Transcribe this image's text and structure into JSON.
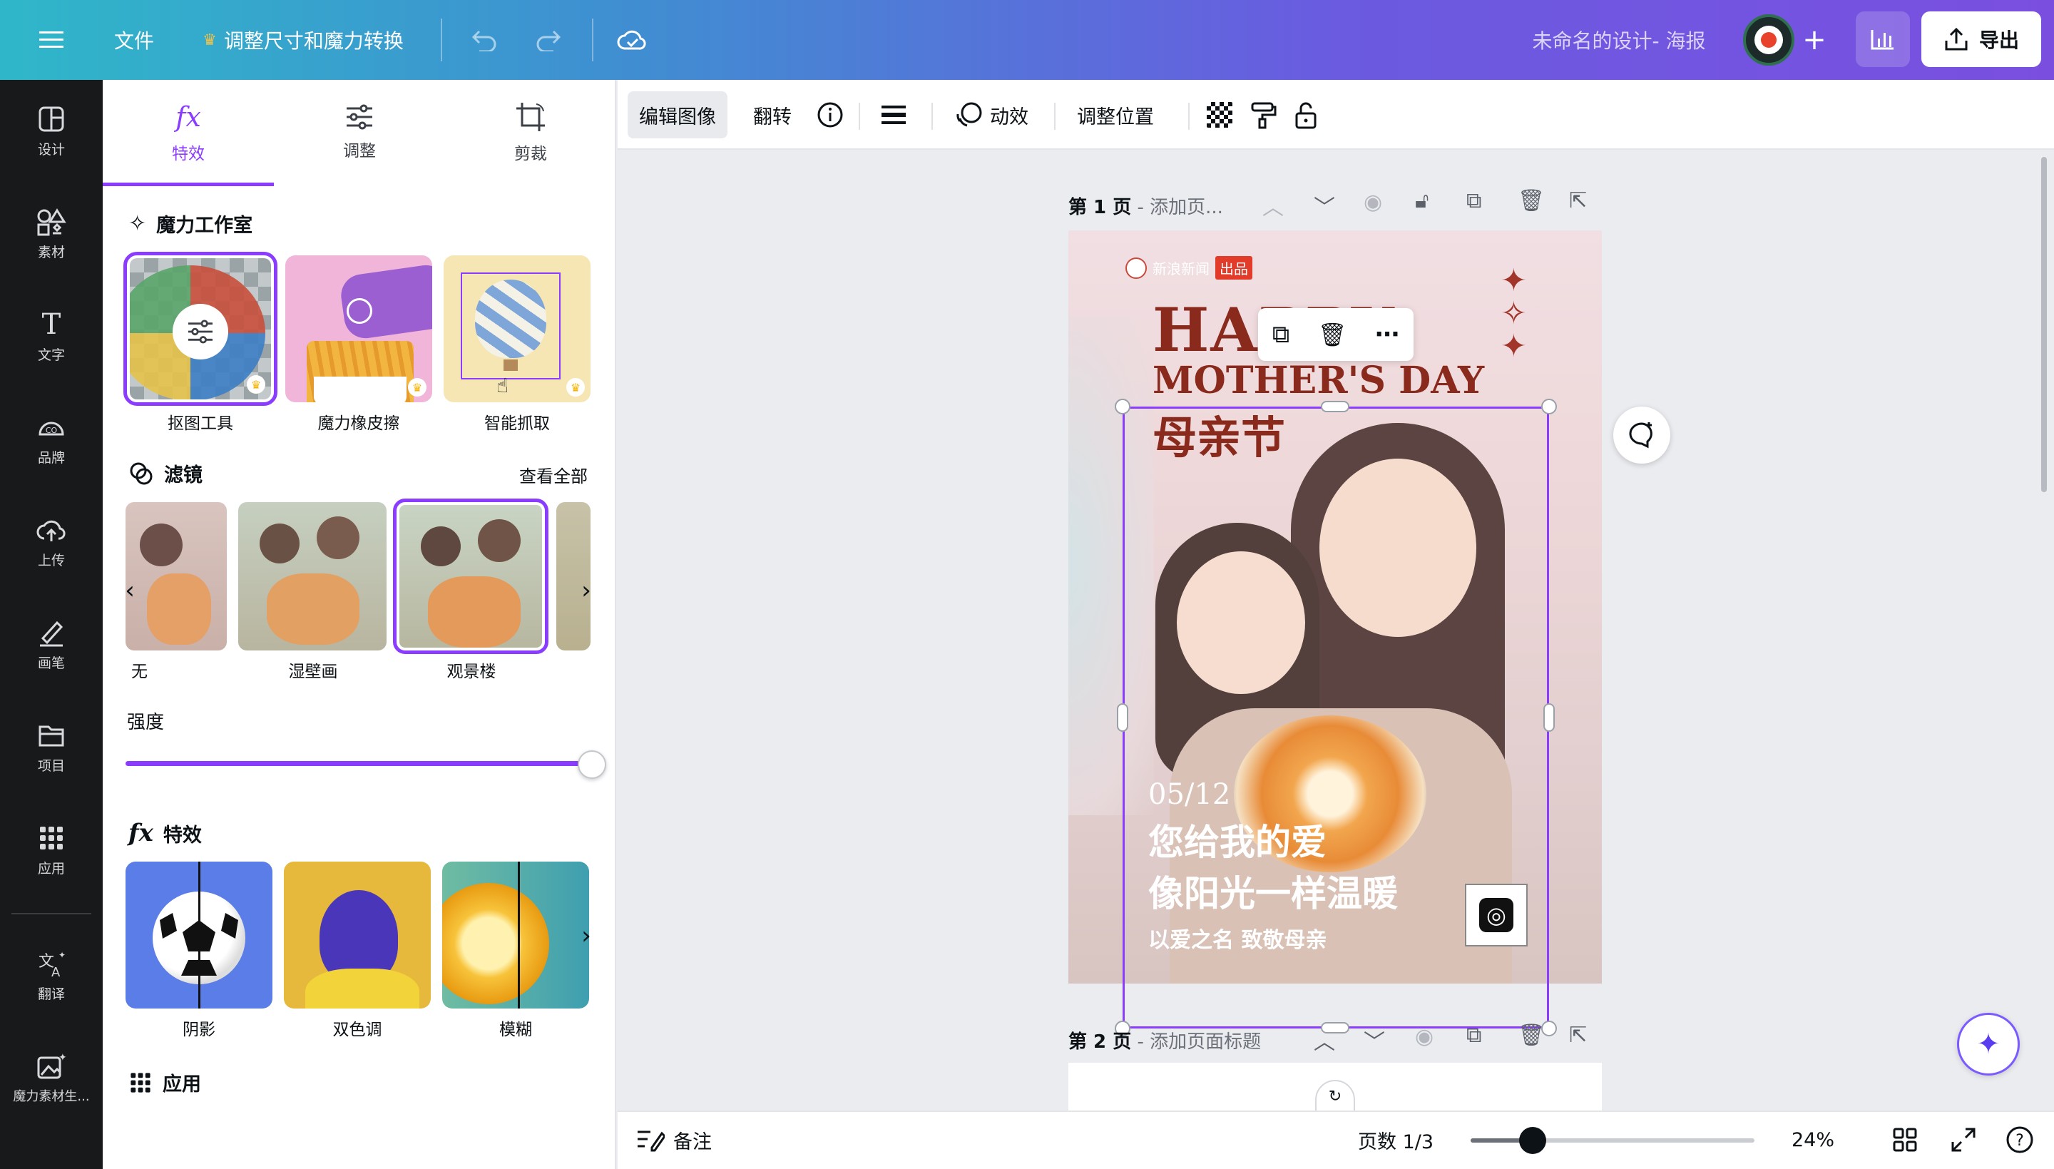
{
  "topbar": {
    "file_label": "文件",
    "resize_label": "调整尺寸和魔力转换",
    "design_title": "未命名的设计- 海报",
    "export_label": "导出",
    "icons": [
      "menu-icon",
      "crown-icon",
      "undo-icon",
      "redo-icon",
      "cloud-save-icon",
      "avatar",
      "plus-icon",
      "chart-icon",
      "upload-icon"
    ]
  },
  "rail": {
    "items": [
      {
        "label": "设计",
        "icon": "layout-icon"
      },
      {
        "label": "素材",
        "icon": "elements-icon"
      },
      {
        "label": "文字",
        "icon": "text-icon"
      },
      {
        "label": "品牌",
        "icon": "brand-icon"
      },
      {
        "label": "上传",
        "icon": "upload-cloud-icon"
      },
      {
        "label": "画笔",
        "icon": "draw-icon"
      },
      {
        "label": "项目",
        "icon": "folder-icon"
      },
      {
        "label": "应用",
        "icon": "apps-icon"
      },
      {
        "label": "翻译",
        "icon": "translate-icon"
      },
      {
        "label": "魔力素材生...",
        "icon": "magic-media-icon"
      }
    ]
  },
  "panel": {
    "tabs": [
      {
        "label": "特效",
        "icon": "fx-icon"
      },
      {
        "label": "调整",
        "icon": "sliders-icon"
      },
      {
        "label": "剪裁",
        "icon": "crop-icon"
      }
    ],
    "magic_studio": {
      "title": "魔力工作室",
      "tools": [
        {
          "label": "抠图工具"
        },
        {
          "label": "魔力橡皮擦"
        },
        {
          "label": "智能抓取"
        }
      ]
    },
    "filters": {
      "title": "滤镜",
      "see_all": "查看全部",
      "items": [
        {
          "label": "无"
        },
        {
          "label": "湿壁画"
        },
        {
          "label": "观景楼"
        }
      ],
      "intensity_label": "强度",
      "intensity_value": 1.0
    },
    "effects": {
      "title": "特效",
      "items": [
        {
          "label": "阴影"
        },
        {
          "label": "双色调"
        },
        {
          "label": "模糊"
        }
      ]
    },
    "apps_title": "应用"
  },
  "context_toolbar": {
    "edit_image": "编辑图像",
    "flip": "翻转",
    "animate": "动效",
    "position": "调整位置"
  },
  "canvas": {
    "page1_label": "第 1 页",
    "page1_sub": "- 添加页...",
    "page2_label": "第 2 页",
    "page2_sub": "- 添加页面标题"
  },
  "poster": {
    "brand_small": "新浪新闻",
    "brand_badge": "出品",
    "headline_1": "HAPPY",
    "headline_2": "MOTHER'S DAY",
    "headline_cn": "母亲节",
    "date": "05/12",
    "line_1": "您给我的爱",
    "line_2": "像阳光一样温暖",
    "line_3": "以爱之名 致敬母亲"
  },
  "bottom": {
    "notes_label": "备注",
    "page_count": "页数 1/3",
    "zoom": "24%",
    "zoom_value": 0.24
  },
  "colors": {
    "accent": "#8b3dff",
    "poster_red": "#8a2a1d",
    "rail_bg": "#18191b"
  }
}
